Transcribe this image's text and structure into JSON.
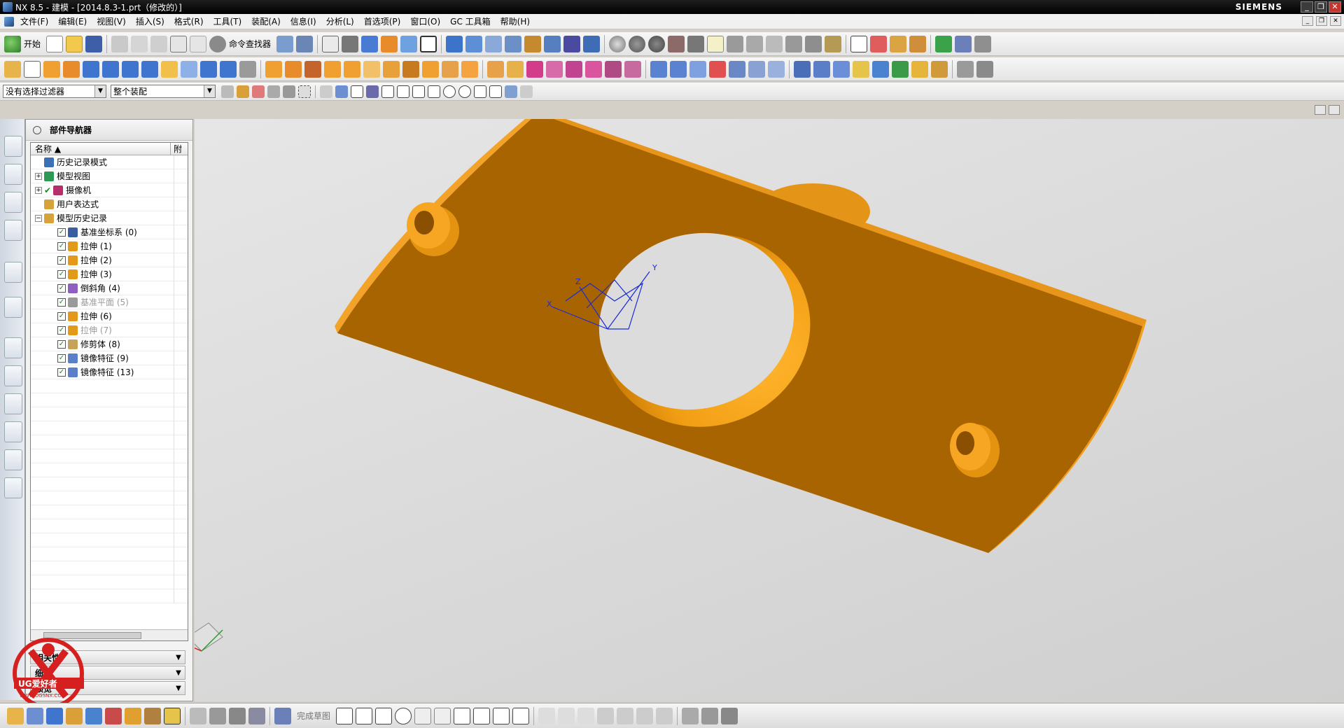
{
  "window": {
    "title": "NX 8.5 - 建模 - [2014.8.3-1.prt（修改的）]",
    "brand": "SIEMENS",
    "controls": [
      "_",
      "❐",
      "✕"
    ]
  },
  "menu": {
    "items": [
      "文件(F)",
      "编辑(E)",
      "视图(V)",
      "插入(S)",
      "格式(R)",
      "工具(T)",
      "装配(A)",
      "信息(I)",
      "分析(L)",
      "首选项(P)",
      "窗口(O)",
      "GC 工具箱",
      "帮助(H)"
    ]
  },
  "toolbar": {
    "start_label": "开始",
    "command_finder": "命令查找器",
    "selection_filter": "没有选择过滤器",
    "assembly_scope": "整个装配"
  },
  "navigator": {
    "title": "部件导航器",
    "col_name": "名称",
    "col_attach": "附",
    "top_items": [
      {
        "label": "历史记录模式",
        "color": "#3b6fb6"
      },
      {
        "label": "模型视图",
        "color": "#2a9a55"
      },
      {
        "label": "摄像机",
        "color": "#b5306a"
      },
      {
        "label": "用户表达式",
        "color": "#d6a23a"
      },
      {
        "label": "模型历史记录",
        "color": "#d6a23a"
      }
    ],
    "features": [
      {
        "label": "基准坐标系 (0)",
        "color": "#3a5fa0",
        "dim": false
      },
      {
        "label": "拉伸 (1)",
        "color": "#e39a1b",
        "dim": false
      },
      {
        "label": "拉伸 (2)",
        "color": "#e39a1b",
        "dim": false
      },
      {
        "label": "拉伸 (3)",
        "color": "#e39a1b",
        "dim": false
      },
      {
        "label": "倒斜角 (4)",
        "color": "#8e5fbf",
        "dim": false
      },
      {
        "label": "基准平面 (5)",
        "color": "#9a9a9a",
        "dim": true
      },
      {
        "label": "拉伸 (6)",
        "color": "#e39a1b",
        "dim": false
      },
      {
        "label": "拉伸 (7)",
        "color": "#e39a1b",
        "dim": true
      },
      {
        "label": "修剪体 (8)",
        "color": "#c7a35a",
        "dim": false
      },
      {
        "label": "镜像特征 (9)",
        "color": "#5b7fc9",
        "dim": false
      },
      {
        "label": "镜像特征 (13)",
        "color": "#5b7fc9",
        "dim": false
      }
    ],
    "sections": [
      "相关性",
      "细节",
      "预览"
    ]
  },
  "statusbar": {
    "finish_sketch": "完成草图"
  },
  "viewport": {
    "triad": {
      "x": "X",
      "y": "Y",
      "z": "Z"
    }
  },
  "logo": {
    "text": "UG爱好者",
    "url": "WWW.UGSNX.COM"
  },
  "colors": {
    "part_face": "#a86400",
    "part_edge": "#f6a623",
    "part_inner": "#f3a117",
    "triad": "#1a2bd6"
  }
}
